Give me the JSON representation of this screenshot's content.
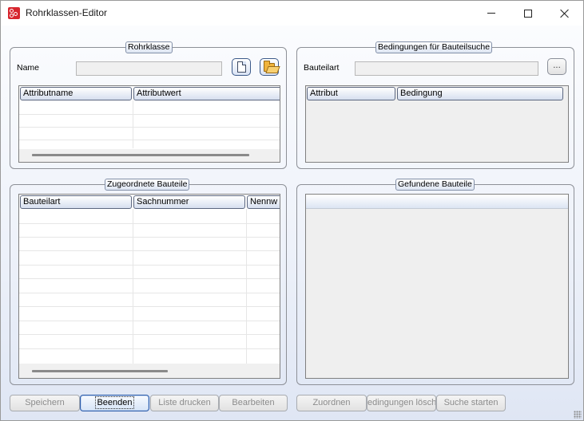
{
  "window": {
    "title": "Rohrklassen-Editor"
  },
  "rohrklasse": {
    "group_title": "Rohrklasse",
    "name_label": "Name",
    "name_value": "",
    "columns": [
      "Attributname",
      "Attributwert"
    ]
  },
  "bedingungen": {
    "group_title": "Bedingungen für Bauteilsuche",
    "bauteilart_label": "Bauteilart",
    "bauteilart_value": "",
    "browse_label": "...",
    "columns": [
      "Attribut",
      "Bedingung"
    ]
  },
  "zugeordnete": {
    "group_title": "Zugeordnete Bauteile",
    "columns": [
      "Bauteilart",
      "Sachnummer",
      "Nennw"
    ]
  },
  "gefundene": {
    "group_title": "Gefundene Bauteile"
  },
  "buttons": {
    "speichern": "Speichern",
    "beenden": "Beenden",
    "liste_drucken": "Liste drucken",
    "bearbeiten": "Bearbeiten",
    "zuordnen": "Zuordnen",
    "bedingungen_loeschen": "edingungen lösche",
    "suche_starten": "Suche starten"
  },
  "icons": {
    "app": "pipe-class-app-icon",
    "new": "new-document-icon",
    "open": "open-folder-icon"
  },
  "colors": {
    "accent": "#2a5aa8",
    "app_icon": "#d7262e",
    "panel_gradient_bottom": "#dfe6f4"
  }
}
